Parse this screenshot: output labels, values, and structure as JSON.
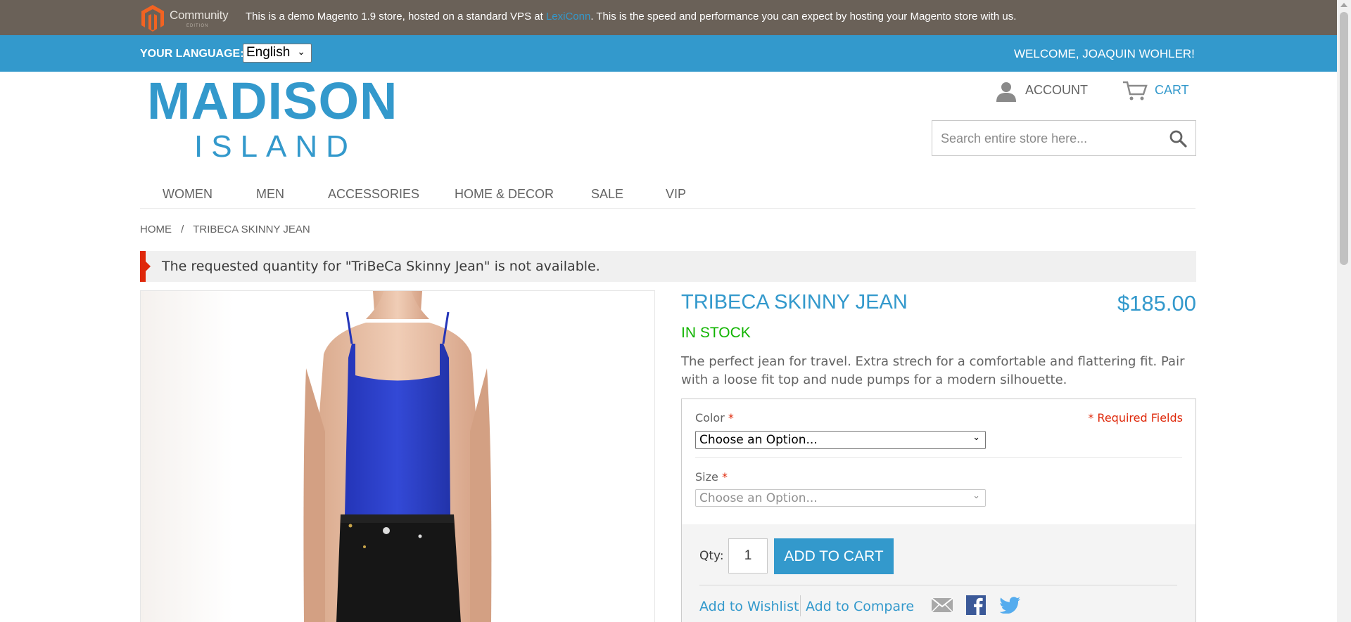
{
  "demo_bar": {
    "logo_word": "Community",
    "logo_sub": "EDITION",
    "text_before": "This is a demo Magento 1.9 store, hosted on a standard VPS at ",
    "link": "LexiConn",
    "text_after": ". This is the speed and performance you can expect by hosting your Magento store with us."
  },
  "language_bar": {
    "label": "YOUR LANGUAGE:",
    "selected": "English",
    "welcome": "WELCOME, JOAQUIN WOHLER!"
  },
  "logo": {
    "line1": "MADISON",
    "line2": "ISLAND"
  },
  "header": {
    "account": "ACCOUNT",
    "cart": "CART",
    "search_placeholder": "Search entire store here..."
  },
  "nav": {
    "items": [
      "WOMEN",
      "MEN",
      "ACCESSORIES",
      "HOME & DECOR",
      "SALE",
      "VIP"
    ]
  },
  "breadcrumb": {
    "home": "HOME",
    "sep": "/",
    "current": "TRIBECA SKINNY JEAN"
  },
  "error": {
    "message": "The requested quantity for \"TriBeCa Skinny Jean\" is not available."
  },
  "product": {
    "name": "TRIBECA SKINNY JEAN",
    "price": "$185.00",
    "stock": "IN STOCK",
    "description": "The perfect jean for travel. Extra strech for a comfortable and flattering fit. Pair with a loose fit top and nude pumps for a modern silhouette."
  },
  "options": {
    "required_note": "* Required Fields",
    "color_label": "Color",
    "color_value": "Choose an Option...",
    "size_label": "Size",
    "size_value": "Choose an Option...",
    "asterisk": "*"
  },
  "cart": {
    "qty_label": "Qty:",
    "qty_value": "1",
    "add_label": "ADD TO CART",
    "wishlist": "Add to Wishlist",
    "compare": "Add to Compare"
  },
  "colors": {
    "accent": "#3399cc",
    "demo_bar": "#6a6158",
    "error_red": "#df280a",
    "in_stock": "#11b400"
  }
}
